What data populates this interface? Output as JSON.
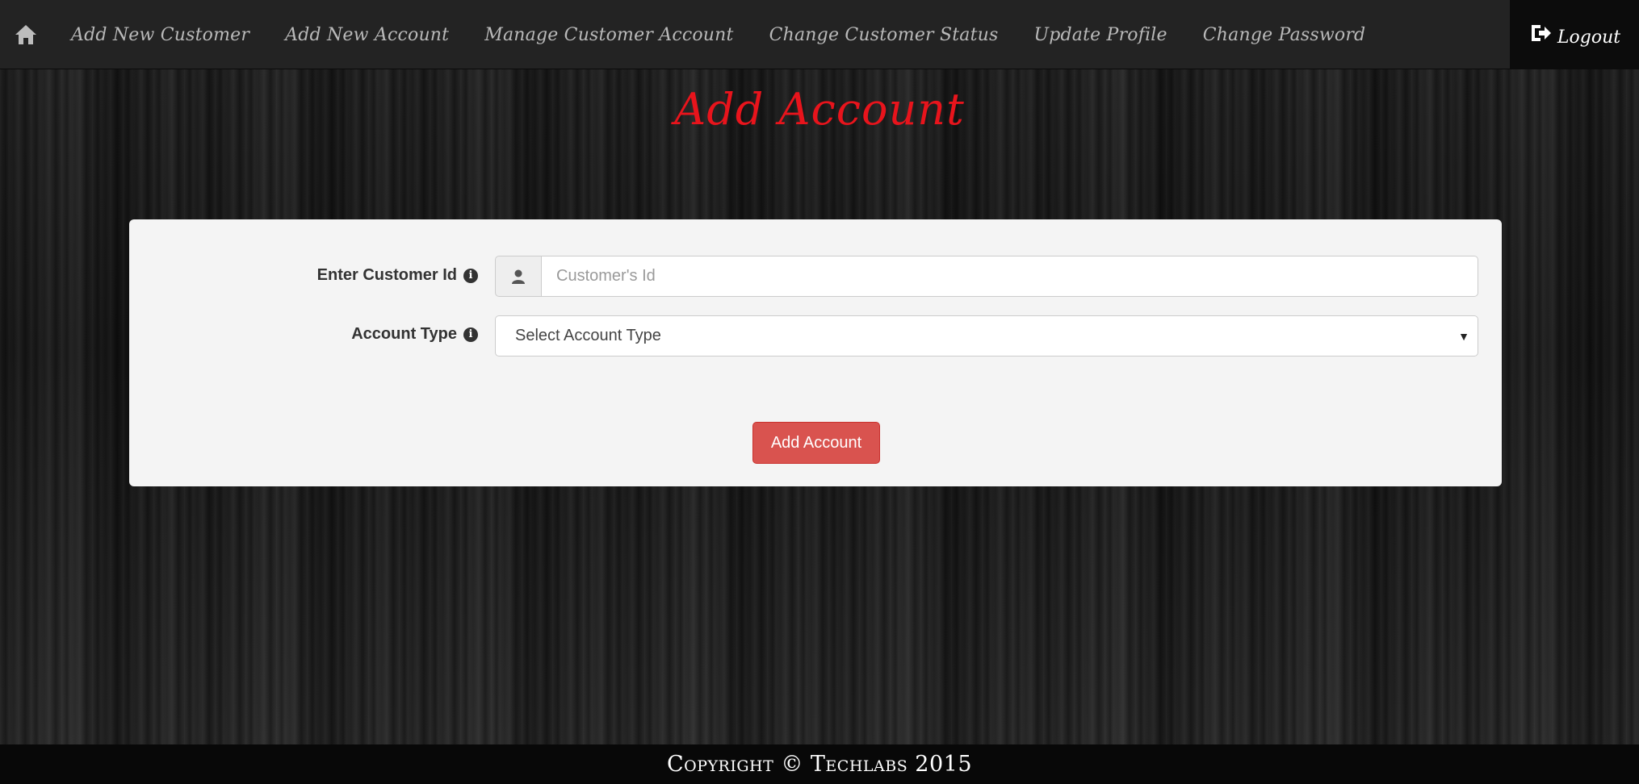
{
  "nav": {
    "home_icon": "home-icon",
    "items": [
      {
        "label": "Add New Customer"
      },
      {
        "label": "Add New Account"
      },
      {
        "label": "Manage Customer Account"
      },
      {
        "label": "Change Customer Status"
      },
      {
        "label": "Update Profile"
      },
      {
        "label": "Change Password"
      }
    ],
    "logout_label": "Logout",
    "logout_icon": "logout-icon"
  },
  "page": {
    "title": "Add Account",
    "title_color": "#e8141c"
  },
  "form": {
    "customer_id": {
      "label": "Enter Customer Id",
      "placeholder": "Customer's Id",
      "value": "",
      "icon": "user-icon"
    },
    "account_type": {
      "label": "Account Type",
      "selected": "Select Account Type"
    },
    "submit_label": "Add Account",
    "submit_color": "#d9534f"
  },
  "footer": {
    "text": "Copyright © Techlabs 2015"
  }
}
